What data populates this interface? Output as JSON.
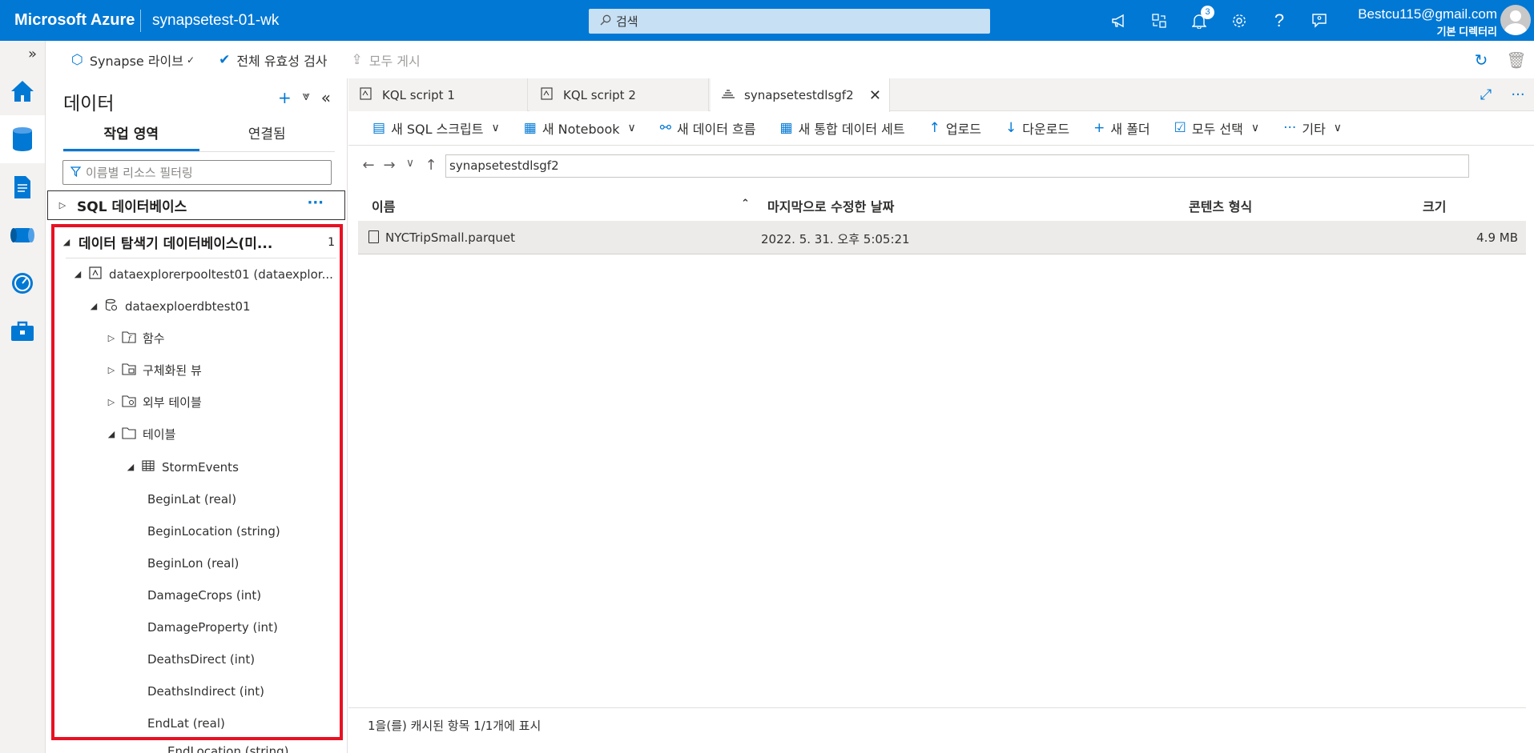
{
  "topbar": {
    "brand": "Microsoft Azure",
    "workspace": "synapsetest-01-wk",
    "search_placeholder": "검색",
    "notifications_count": "3",
    "user_email": "Bestcu115@gmail.com",
    "user_directory": "기본 디렉터리"
  },
  "actionbar": {
    "synapse_live": "Synapse 라이브",
    "validate_all": "전체 유효성 검사",
    "publish_all": "모두 게시"
  },
  "leftpane": {
    "title": "데이터",
    "tabs": [
      "작업 영역",
      "연결됨"
    ],
    "filter_placeholder": "이름별 리소스 필터링",
    "sql_db": "SQL 데이터베이스",
    "sql_db_more": "···",
    "tree": {
      "explorer_db": "데이터 탐색기 데이터베이스(미...",
      "explorer_db_count": "1",
      "pool": "dataexplorerpooltest01 (dataexplor...",
      "database": "dataexploerdbtest01",
      "functions": "함수",
      "materialized_views": "구체화된 뷰",
      "external_tables": "외부 테이블",
      "tables": "테이블",
      "table_name": "StormEvents",
      "columns": [
        "BeginLat (real)",
        "BeginLocation (string)",
        "BeginLon (real)",
        "DamageCrops (int)",
        "DamageProperty (int)",
        "DeathsDirect (int)",
        "DeathsIndirect (int)",
        "EndLat (real)"
      ],
      "below_box": "EndLocation (string)"
    }
  },
  "tabs": [
    {
      "label": "KQL script 1"
    },
    {
      "label": "KQL script 2"
    },
    {
      "label": "synapsetestdlsgf2"
    }
  ],
  "toolbar": {
    "new_sql": "새 SQL 스크립트",
    "new_notebook": "새 Notebook",
    "new_dataflow": "새 데이터 흐름",
    "new_dataset": "새 통합 데이터 세트",
    "upload": "업로드",
    "download": "다운로드",
    "new_folder": "새 폴더",
    "select_all": "모두 선택",
    "more": "기타"
  },
  "path": "synapsetestdlsgf2",
  "files": {
    "headers": [
      "이름",
      "마지막으로 수정한 날짜",
      "콘텐츠 형식",
      "크기"
    ],
    "rows": [
      {
        "name": "NYCTripSmall.parquet",
        "modified": "2022. 5. 31. 오후 5:05:21",
        "type": "",
        "size": "4.9 MB"
      }
    ]
  },
  "status": "1을(를) 캐시된 항목 1/1개에 표시"
}
